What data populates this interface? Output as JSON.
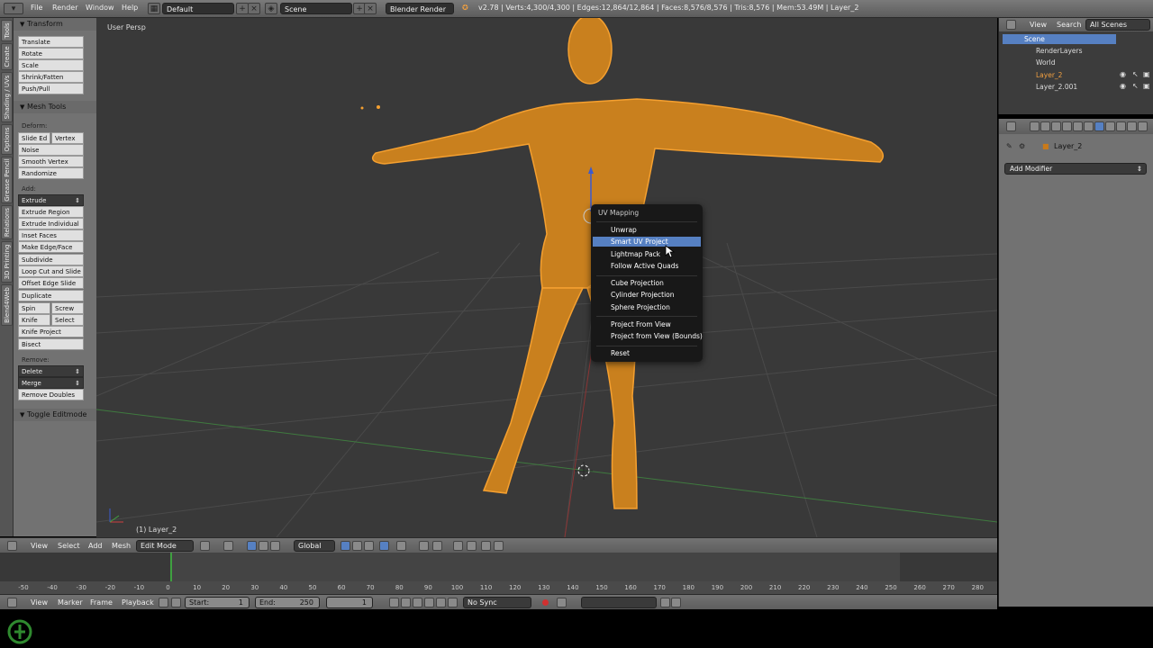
{
  "topbar": {
    "menus": [
      "File",
      "Render",
      "Window",
      "Help"
    ],
    "screen_layout": "Default",
    "scene": "Scene",
    "engine": "Blender Render",
    "stats": "v2.78 | Verts:4,300/4,300 | Edges:12,864/12,864 | Faces:8,576/8,576 | Tris:8,576 | Mem:53.49M | Layer_2"
  },
  "tabs": [
    "Tools",
    "Create",
    "Shading / UVs",
    "Options",
    "Grease Pencil",
    "Relations",
    "3D Printing",
    "Blend4Web"
  ],
  "toolshelf": {
    "transform_header": "Transform",
    "transform_buttons": [
      "Translate",
      "Rotate",
      "Scale",
      "Shrink/Fatten",
      "Push/Pull"
    ],
    "mesh_tools_header": "Mesh Tools",
    "deform_label": "Deform:",
    "slide_edge": "Slide Ed",
    "vertex": "Vertex",
    "noise": "Noise",
    "smooth_vertex": "Smooth Vertex",
    "randomize": "Randomize",
    "add_label": "Add:",
    "extrude": "Extrude",
    "add_buttons": [
      "Extrude Region",
      "Extrude Individual",
      "Inset Faces",
      "Make Edge/Face",
      "Subdivide",
      "Loop Cut and Slide",
      "Offset Edge Slide",
      "Duplicate"
    ],
    "spin": "Spin",
    "screw": "Screw",
    "knife": "Knife",
    "select": "Select",
    "knife_project": "Knife Project",
    "bisect": "Bisect",
    "remove_label": "Remove:",
    "delete": "Delete",
    "merge": "Merge",
    "remove_doubles": "Remove Doubles",
    "toggle_editmode": "Toggle Editmode"
  },
  "viewport": {
    "view_name": "User Persp",
    "object_label": "(1) Layer_2",
    "mesh_color": "#f5a030"
  },
  "uv_menu": {
    "title": "UV Mapping",
    "items_group1": [
      "Unwrap",
      "Smart UV Project",
      "Lightmap Pack",
      "Follow Active Quads"
    ],
    "items_group2": [
      "Cube Projection",
      "Cylinder Projection",
      "Sphere Projection"
    ],
    "items_group3": [
      "Project From View",
      "Project from View (Bounds)"
    ],
    "items_group4": [
      "Reset"
    ],
    "highlighted": "Smart UV Project",
    "highlight_color": "#5680c2"
  },
  "view_header": {
    "menus": [
      "View",
      "Select",
      "Add",
      "Mesh"
    ],
    "mode": "Edit Mode",
    "orientation": "Global"
  },
  "timeline": {
    "ticks": [
      "-50",
      "-40",
      "-30",
      "-20",
      "-10",
      "0",
      "10",
      "20",
      "30",
      "40",
      "50",
      "60",
      "70",
      "80",
      "90",
      "100",
      "110",
      "120",
      "130",
      "140",
      "150",
      "160",
      "170",
      "180",
      "190",
      "200",
      "210",
      "220",
      "230",
      "240",
      "250",
      "260",
      "270",
      "280"
    ],
    "current_frame_marker": "0"
  },
  "timeline_header": {
    "menus": [
      "View",
      "Marker",
      "Frame",
      "Playback"
    ],
    "start_label": "Start:",
    "start_value": "1",
    "end_label": "End:",
    "end_value": "250",
    "current_frame": "1",
    "sync": "No Sync"
  },
  "outliner": {
    "view": "View",
    "search": "Search",
    "filter": "All Scenes",
    "items": [
      "Scene",
      "RenderLayers",
      "World",
      "Layer_2",
      "Layer_2.001"
    ]
  },
  "properties": {
    "object_name": "Layer_2",
    "add_modifier": "Add Modifier"
  }
}
